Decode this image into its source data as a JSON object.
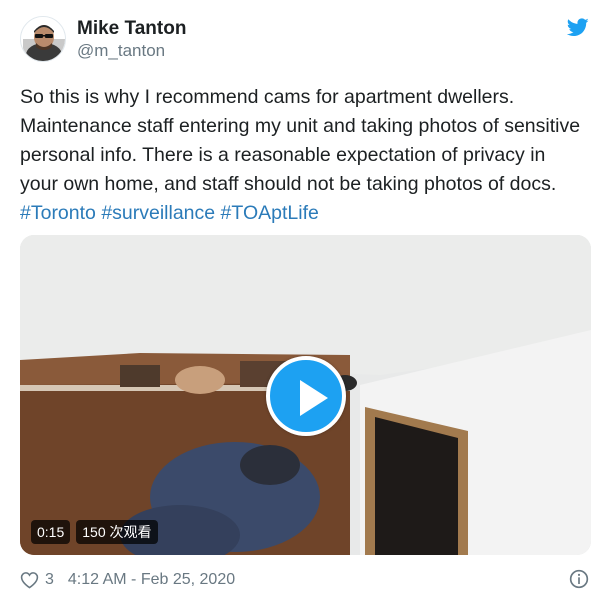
{
  "author": {
    "name": "Mike Tanton",
    "handle": "@m_tanton"
  },
  "tweet": {
    "text_main": "So this is why I recommend cams for apartment dwellers. Maintenance staff entering my unit and taking photos of sensitive personal info. There is a reasonable expectation of privacy in your own home, and staff should not be taking photos of docs.",
    "hashtags": [
      "#Toronto",
      "#surveillance",
      "#TOAptLife"
    ]
  },
  "video": {
    "duration": "0:15",
    "views": "150 次观看"
  },
  "footer": {
    "likes": "3",
    "timestamp": "4:12 AM - Feb 25, 2020"
  },
  "colors": {
    "accent": "#1da1f2",
    "hashtag": "#2b7bb9",
    "muted": "#697882",
    "text": "#1c2022"
  },
  "icons": {
    "brand": "twitter-bird-icon",
    "like": "heart-icon",
    "info": "info-icon",
    "play": "play-icon"
  }
}
